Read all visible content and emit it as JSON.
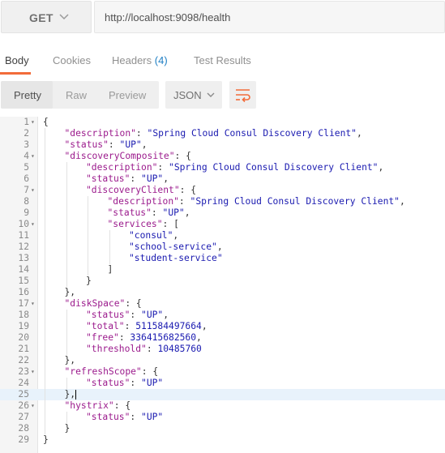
{
  "request": {
    "method": "GET",
    "url": "http://localhost:9098/health"
  },
  "tabs": [
    {
      "label": "Body"
    },
    {
      "label": "Cookies"
    },
    {
      "label": "Headers",
      "count": "(4)"
    },
    {
      "label": "Test Results"
    }
  ],
  "toolbar": {
    "views": [
      "Pretty",
      "Raw",
      "Preview"
    ],
    "format": "JSON"
  },
  "colors": {
    "accent": "#f26b3a",
    "key": "#9b1a8c",
    "string": "#1a1ab0",
    "link": "#1f7fc4"
  },
  "code_lines": [
    {
      "n": "1",
      "fold": "▾",
      "indent": 0,
      "parts": [
        [
          "p",
          "{"
        ]
      ]
    },
    {
      "n": "2",
      "fold": "",
      "indent": 1,
      "parts": [
        [
          "k",
          "\"description\""
        ],
        [
          "p",
          ": "
        ],
        [
          "s",
          "\"Spring Cloud Consul Discovery Client\""
        ],
        [
          "p",
          ","
        ]
      ]
    },
    {
      "n": "3",
      "fold": "",
      "indent": 1,
      "parts": [
        [
          "k",
          "\"status\""
        ],
        [
          "p",
          ": "
        ],
        [
          "s",
          "\"UP\""
        ],
        [
          "p",
          ","
        ]
      ]
    },
    {
      "n": "4",
      "fold": "▾",
      "indent": 1,
      "parts": [
        [
          "k",
          "\"discoveryComposite\""
        ],
        [
          "p",
          ": {"
        ]
      ]
    },
    {
      "n": "5",
      "fold": "",
      "indent": 2,
      "parts": [
        [
          "k",
          "\"description\""
        ],
        [
          "p",
          ": "
        ],
        [
          "s",
          "\"Spring Cloud Consul Discovery Client\""
        ],
        [
          "p",
          ","
        ]
      ]
    },
    {
      "n": "6",
      "fold": "",
      "indent": 2,
      "parts": [
        [
          "k",
          "\"status\""
        ],
        [
          "p",
          ": "
        ],
        [
          "s",
          "\"UP\""
        ],
        [
          "p",
          ","
        ]
      ]
    },
    {
      "n": "7",
      "fold": "▾",
      "indent": 2,
      "parts": [
        [
          "k",
          "\"discoveryClient\""
        ],
        [
          "p",
          ": {"
        ]
      ]
    },
    {
      "n": "8",
      "fold": "",
      "indent": 3,
      "parts": [
        [
          "k",
          "\"description\""
        ],
        [
          "p",
          ": "
        ],
        [
          "s",
          "\"Spring Cloud Consul Discovery Client\""
        ],
        [
          "p",
          ","
        ]
      ]
    },
    {
      "n": "9",
      "fold": "",
      "indent": 3,
      "parts": [
        [
          "k",
          "\"status\""
        ],
        [
          "p",
          ": "
        ],
        [
          "s",
          "\"UP\""
        ],
        [
          "p",
          ","
        ]
      ]
    },
    {
      "n": "10",
      "fold": "▾",
      "indent": 3,
      "parts": [
        [
          "k",
          "\"services\""
        ],
        [
          "p",
          ": ["
        ]
      ]
    },
    {
      "n": "11",
      "fold": "",
      "indent": 4,
      "parts": [
        [
          "s",
          "\"consul\""
        ],
        [
          "p",
          ","
        ]
      ]
    },
    {
      "n": "12",
      "fold": "",
      "indent": 4,
      "parts": [
        [
          "s",
          "\"school-service\""
        ],
        [
          "p",
          ","
        ]
      ]
    },
    {
      "n": "13",
      "fold": "",
      "indent": 4,
      "parts": [
        [
          "s",
          "\"student-service\""
        ]
      ]
    },
    {
      "n": "14",
      "fold": "",
      "indent": 3,
      "parts": [
        [
          "p",
          "]"
        ]
      ]
    },
    {
      "n": "15",
      "fold": "",
      "indent": 2,
      "parts": [
        [
          "p",
          "}"
        ]
      ]
    },
    {
      "n": "16",
      "fold": "",
      "indent": 1,
      "parts": [
        [
          "p",
          "},"
        ]
      ]
    },
    {
      "n": "17",
      "fold": "▾",
      "indent": 1,
      "parts": [
        [
          "k",
          "\"diskSpace\""
        ],
        [
          "p",
          ": {"
        ]
      ]
    },
    {
      "n": "18",
      "fold": "",
      "indent": 2,
      "parts": [
        [
          "k",
          "\"status\""
        ],
        [
          "p",
          ": "
        ],
        [
          "s",
          "\"UP\""
        ],
        [
          "p",
          ","
        ]
      ]
    },
    {
      "n": "19",
      "fold": "",
      "indent": 2,
      "parts": [
        [
          "k",
          "\"total\""
        ],
        [
          "p",
          ": "
        ],
        [
          "n",
          "511584497664"
        ],
        [
          "p",
          ","
        ]
      ]
    },
    {
      "n": "20",
      "fold": "",
      "indent": 2,
      "parts": [
        [
          "k",
          "\"free\""
        ],
        [
          "p",
          ": "
        ],
        [
          "n",
          "336415682560"
        ],
        [
          "p",
          ","
        ]
      ]
    },
    {
      "n": "21",
      "fold": "",
      "indent": 2,
      "parts": [
        [
          "k",
          "\"threshold\""
        ],
        [
          "p",
          ": "
        ],
        [
          "n",
          "10485760"
        ]
      ]
    },
    {
      "n": "22",
      "fold": "",
      "indent": 1,
      "parts": [
        [
          "p",
          "},"
        ]
      ]
    },
    {
      "n": "23",
      "fold": "▾",
      "indent": 1,
      "parts": [
        [
          "k",
          "\"refreshScope\""
        ],
        [
          "p",
          ": {"
        ]
      ]
    },
    {
      "n": "24",
      "fold": "",
      "indent": 2,
      "parts": [
        [
          "k",
          "\"status\""
        ],
        [
          "p",
          ": "
        ],
        [
          "s",
          "\"UP\""
        ]
      ]
    },
    {
      "n": "25",
      "fold": "",
      "indent": 1,
      "cursor": true,
      "parts": [
        [
          "p",
          "},"
        ]
      ]
    },
    {
      "n": "26",
      "fold": "▾",
      "indent": 1,
      "parts": [
        [
          "k",
          "\"hystrix\""
        ],
        [
          "p",
          ": {"
        ]
      ]
    },
    {
      "n": "27",
      "fold": "",
      "indent": 2,
      "parts": [
        [
          "k",
          "\"status\""
        ],
        [
          "p",
          ": "
        ],
        [
          "s",
          "\"UP\""
        ]
      ]
    },
    {
      "n": "28",
      "fold": "",
      "indent": 1,
      "parts": [
        [
          "p",
          "}"
        ]
      ]
    },
    {
      "n": "29",
      "fold": "",
      "indent": 0,
      "parts": [
        [
          "p",
          "}"
        ]
      ]
    }
  ]
}
